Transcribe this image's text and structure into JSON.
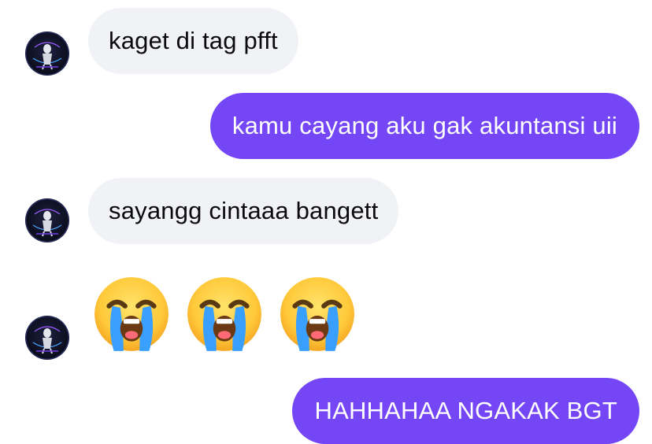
{
  "conversation": {
    "messages": [
      {
        "side": "incoming",
        "text": "kaget di tag pfft"
      },
      {
        "side": "outgoing",
        "text": "kamu cayang aku gak akuntansi uii"
      },
      {
        "side": "incoming",
        "text": "sayangg cintaaa bangett"
      },
      {
        "side": "incoming",
        "emoji": [
          "loudly-crying-face",
          "loudly-crying-face",
          "loudly-crying-face"
        ]
      },
      {
        "side": "outgoing",
        "text": "HAHHAHAA NGAKAK BGT"
      }
    ]
  },
  "colors": {
    "outgoing_bubble": "#7446f6",
    "incoming_bubble": "#f1f2f6"
  },
  "icons": {
    "avatar": "avatar-astronaut-icon",
    "emoji": "loudly-crying-face-icon"
  }
}
